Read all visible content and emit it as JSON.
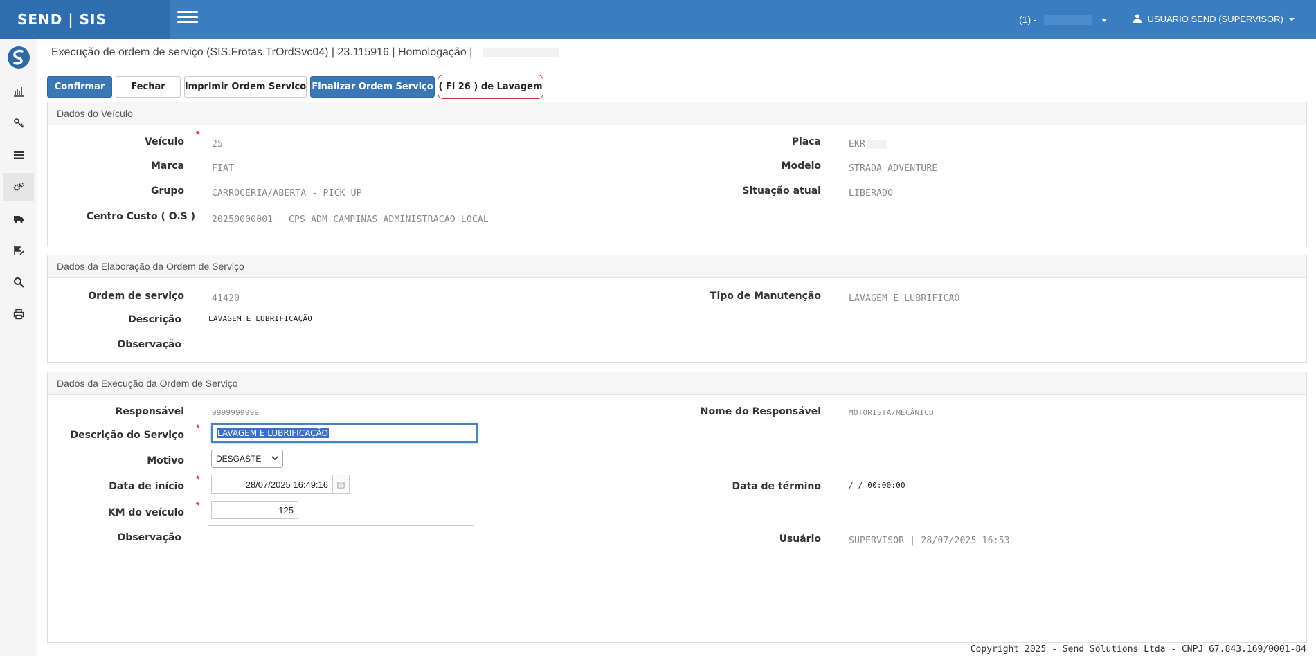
{
  "topbar": {
    "brand": "SEND | SIS",
    "company_label": "(1) -",
    "user_label": "USUARIO SEND (SUPERVISOR)"
  },
  "page": {
    "title": "Execução de ordem de serviço (SIS.Frotas.TrOrdSvc04) | 23.115916 | Homologação |"
  },
  "toolbar": {
    "confirm": "Confirmar",
    "close": "Fechar",
    "print": "Imprimir Ordem Serviço",
    "finalize": "Finalizar Ordem Serviço",
    "wash": "( Fi 26 ) de Lavagem"
  },
  "vehicle": {
    "title": "Dados do Veículo",
    "vehicle_label": "Veículo",
    "vehicle_value": "25",
    "brand_label": "Marca",
    "brand_value": "FIAT",
    "group_label": "Grupo",
    "group_value": "CARROCERIA/ABERTA - PICK UP",
    "cost_center_label": "Centro Custo ( O.S )",
    "cost_center_code": "20250000001",
    "cost_center_name": "CPS ADM CAMPINAS ADMINISTRACAO LOCAL",
    "plate_label": "Placa",
    "plate_value": "EKR",
    "model_label": "Modelo",
    "model_value": "STRADA ADVENTURE",
    "status_label": "Situação atual",
    "status_value": "LIBERADO"
  },
  "elaboration": {
    "title": "Dados da Elaboração da Ordem de Serviço",
    "order_label": "Ordem de serviço",
    "order_value": "41420",
    "desc_label": "Descrição",
    "desc_value": "LAVAGEM E LUBRIFICAÇÃO",
    "obs_label": "Observação",
    "maint_label": "Tipo de Manutenção",
    "maint_value": "LAVAGEM E LUBRIFICAO"
  },
  "execution": {
    "title": "Dados da Execução da Ordem de Serviço",
    "resp_label": "Responsável",
    "resp_value": "9999999999",
    "resp_name_label": "Nome do Responsável",
    "resp_name_value": "MOTORISTA/MECÂNICO",
    "service_desc_label": "Descrição do Serviço",
    "service_desc_value": "LAVAGEM E LUBRIFICAÇÃO",
    "reason_label": "Motivo",
    "reason_value": "DESGASTE",
    "start_label": "Data de início",
    "start_value": "28/07/2025 16:49:16",
    "end_label": "Data de término",
    "end_value": "/ / 00:00:00",
    "km_label": "KM do veículo",
    "km_value": "125",
    "obs_label": "Observação",
    "user_label": "Usuário",
    "user_value": "SUPERVISOR | 28/07/2025 16:53"
  },
  "footer": {
    "copyright": "Copyright 2025 - Send Solutions Ltda - CNPJ 67.843.169/0001-84"
  }
}
